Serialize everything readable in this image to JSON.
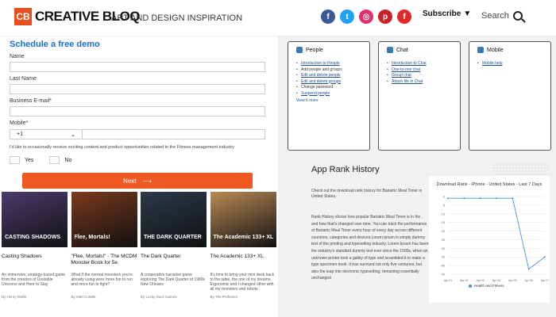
{
  "header": {
    "logo_mark": "CB",
    "logo_text": "CREATIVE BLOQ",
    "tagline": "ART AND DESIGN INSPIRATION",
    "subscribe_label": "Subscribe",
    "search_label": "Search",
    "social": [
      {
        "name": "facebook-icon",
        "glyph": "f",
        "color": "#3b5998"
      },
      {
        "name": "twitter-icon",
        "glyph": "t",
        "color": "#1da1f2"
      },
      {
        "name": "instagram-icon",
        "glyph": "◎",
        "color": "#e1306c"
      },
      {
        "name": "pinterest-icon",
        "glyph": "p",
        "color": "#cb2027"
      },
      {
        "name": "flipboard-icon",
        "glyph": "f",
        "color": "#e12828"
      }
    ]
  },
  "demo_form": {
    "title": "Schedule a free demo",
    "name_label": "Name",
    "last_name_label": "Last Name",
    "email_label": "Business E-mail*",
    "mobile_label": "Mobile*",
    "country_code": "+1",
    "consent_text": "I'd like to occasionally receive exciting content and product opportunities related to the Fitness management industry",
    "yes_label": "Yes",
    "no_label": "No",
    "next_label": "Next",
    "accent_color": "#f05a22"
  },
  "articles": [
    {
      "thumb_text": "CASTING SHADOWS",
      "title": "Casting Shadows",
      "desc": "An immersive, strategy-based game from the creators of Unstable Unicorns and Here to Slay",
      "author": "By Henry Wolfe",
      "bg": "#4a3b6b"
    },
    {
      "thumb_text": "Flee, Mortals!",
      "title": "\"Flee, Mortals!\" - The MCDM Monster Book for 5e",
      "desc": "What if the normal monsters you're already using were more fun to run and more fun to fight?",
      "author": "By Matt Colville",
      "bg": "#7a3a1c"
    },
    {
      "thumb_text": "THE DARK QUARTER",
      "title": "The Dark Quarter",
      "desc": "A cooperative narrative game exploring The Dark Quarter of 1980s New Orleans",
      "author": "By Lucky Duck Games",
      "bg": "#2b3a4a"
    },
    {
      "thumb_text": "The Academic 133+ XL",
      "title": "The Academic 133+ XL",
      "desc": "It's time to bring your mini desk back to the table, the one of my dreams. Ergonomic and I changed other with all my monsters and robots",
      "author": "By The Professor",
      "bg": "#b98a54"
    }
  ],
  "cards": [
    {
      "title": "People",
      "items": [
        "Introduction to People",
        "Add people and groups",
        "Edit and delete people",
        "Edit and delete groups",
        "Change password",
        "Suspend people"
      ],
      "links": [
        true,
        false,
        true,
        true,
        false,
        true
      ],
      "view_more": "View 6 more"
    },
    {
      "title": "Chat",
      "items": [
        "Introduction to Chat",
        "One-to-one chat",
        "Group chat",
        "Attach file in Chat"
      ],
      "links": [
        true,
        true,
        true,
        true
      ],
      "view_more": ""
    },
    {
      "title": "Mobile",
      "items": [
        "Mobile help"
      ],
      "links": [
        true
      ],
      "view_more": ""
    }
  ],
  "rank": {
    "title": "App Rank History",
    "subtitle": "Check out the download rank history for Bariatric Meal Timer in United States.",
    "body": "Rank History shows how popular Bariatric Meal Timer is in the , and how that's changed over time. You can track the performance of Bariatric Meal Timer every hour of every day across different countries, categories and devices.Lorem Ipsum is simply dummy text of the printing and typesetting industry. Lorem Ipsum has been the industry's standard dummy text ever since the 1500s, when an unknown printer took a galley of type and scrambled it to make a type specimen book. It has survived not only five centuries, but also the leap into electronic typesetting, remaining essentially unchanged"
  },
  "chart_data": {
    "type": "line",
    "title": "Download Rank - iPhone - United States - Last 7 Days",
    "categories": [
      "Apr 01",
      "Apr 02",
      "Apr 03",
      "Apr 04",
      "Apr 05",
      "Apr 06",
      "Apr 07"
    ],
    "series": [
      {
        "name": "Health and Fitness",
        "values": [
          1,
          1,
          1,
          1,
          1,
          42,
          35
        ]
      }
    ],
    "yticks": [
      0,
      5,
      10,
      15,
      20,
      25,
      30,
      35,
      40,
      45
    ],
    "ylim": [
      0,
      45
    ],
    "line_color": "#4a90d9",
    "legend_position": "bottom"
  }
}
